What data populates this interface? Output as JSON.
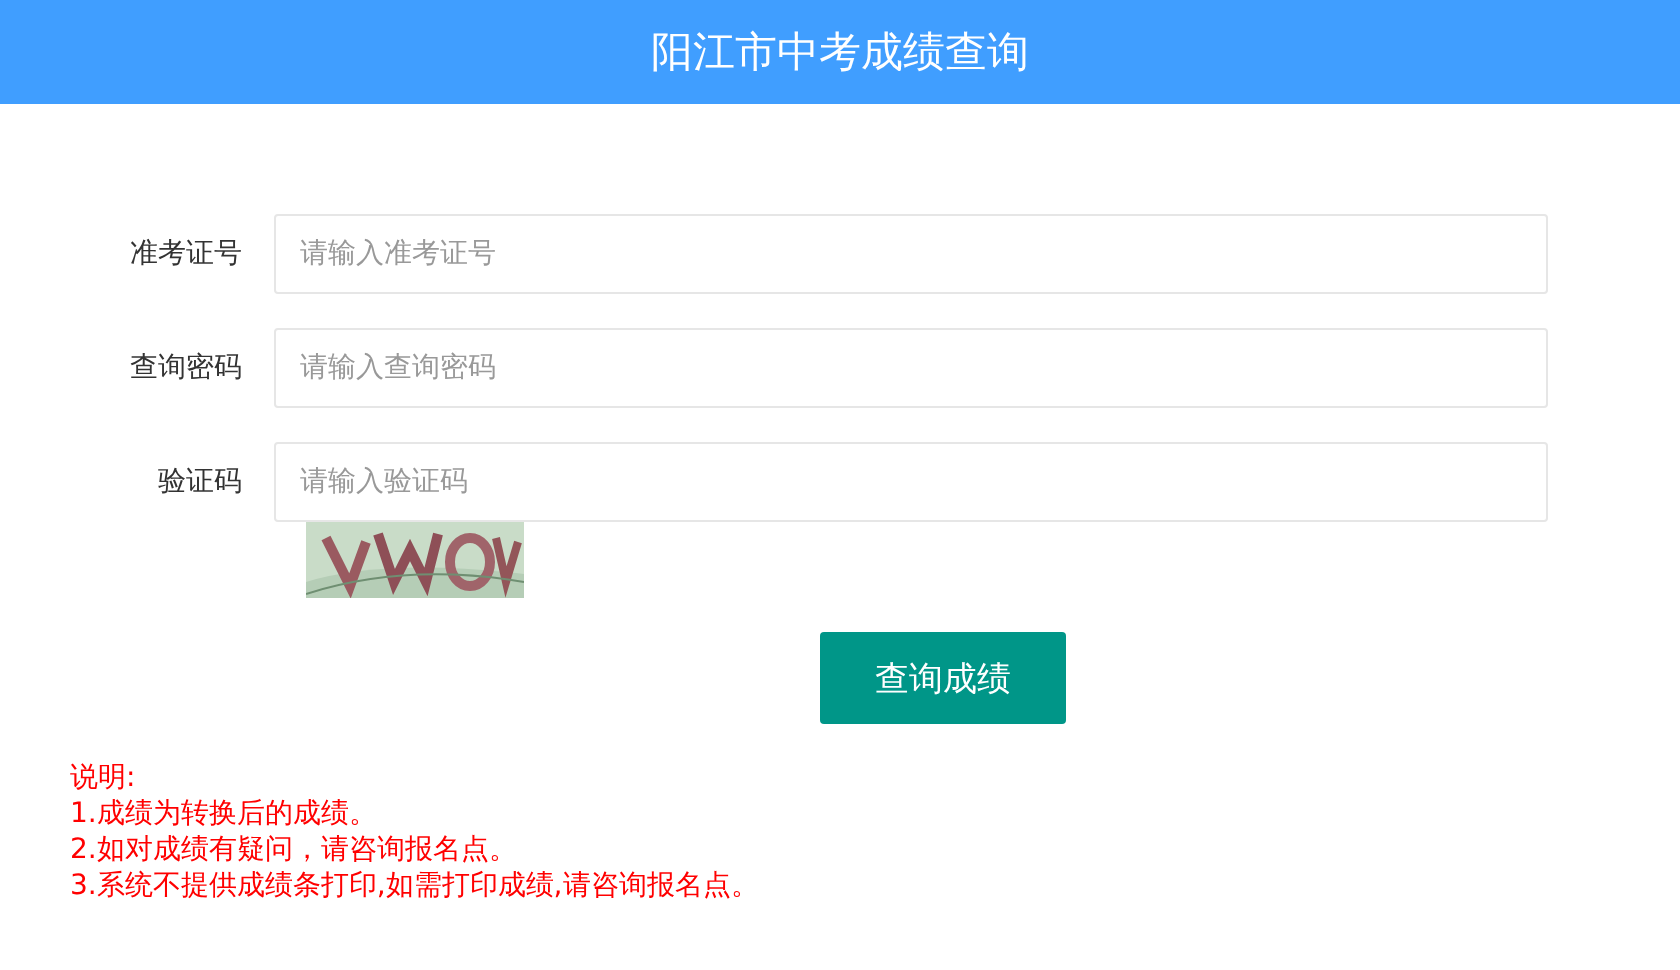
{
  "header": {
    "title": "阳江市中考成绩查询"
  },
  "fields": [
    {
      "label": "准考证号",
      "placeholder": "请输入准考证号"
    },
    {
      "label": "查询密码",
      "placeholder": "请输入查询密码"
    },
    {
      "label": "验证码",
      "placeholder": "请输入验证码"
    }
  ],
  "submit": "查询成绩",
  "notes": [
    "说明:",
    "1.成绩为转换后的成绩。",
    "2.如对成绩有疑问，请咨询报名点。",
    "3.系统不提供成绩条打印,如需打印成绩,请咨询报名点。"
  ]
}
